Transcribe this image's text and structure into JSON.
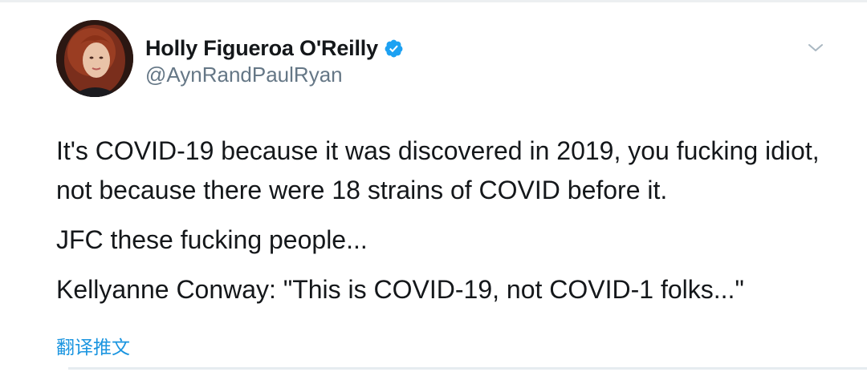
{
  "author": {
    "display_name": "Holly Figueroa O'Reilly",
    "handle": "@AynRandPaulRyan",
    "verified": true
  },
  "tweet": {
    "paragraphs": [
      "It's COVID-19 because it was discovered in 2019, you fucking idiot, not because there were 18 strains of COVID before it.",
      "JFC these fucking people...",
      "Kellyanne Conway: \"This is COVID-19, not COVID-1 folks...\""
    ]
  },
  "actions": {
    "translate_label": "翻译推文",
    "more_menu_icon": "chevron-down-icon"
  },
  "colors": {
    "text": "#14171a",
    "secondary": "#657786",
    "accent": "#1b95e0",
    "verified": "#1da1f2"
  }
}
